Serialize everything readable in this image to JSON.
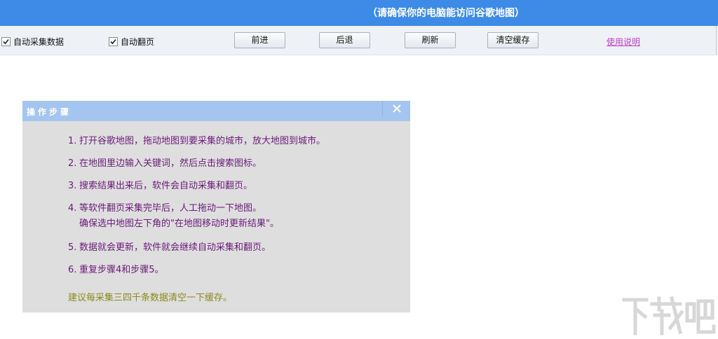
{
  "banner": {
    "text": "（请确保你的电脑能访问谷歌地图）",
    "color": "#3d8be6"
  },
  "toolbar": {
    "auto_collect_label": "自动采集数据",
    "auto_collect_checked": true,
    "auto_page_label": "自动翻页",
    "auto_page_checked": true,
    "forward_label": "前进",
    "back_label": "后退",
    "refresh_label": "刷新",
    "clear_cache_label": "清空缓存",
    "help_label": "使用说明"
  },
  "panel": {
    "title": "操作步骤",
    "close_icon": "close-icon",
    "steps": [
      {
        "num": "1.",
        "text": "打开谷歌地图，拖动地图到要采集的城市，放大地图到城市。"
      },
      {
        "num": "2.",
        "text": "在地图里边输入关键词，然后点击搜索图标。"
      },
      {
        "num": "3.",
        "text": "搜索结果出来后，软件会自动采集和翻页。"
      },
      {
        "num": "4.",
        "text": "等软件翻页采集完毕后，人工拖动一下地图。",
        "text2": "确保选中地图左下角的\"在地图移动时更新结果\"。"
      },
      {
        "num": "5.",
        "text": "数据就会更新，软件就会继续自动采集和翻页。"
      },
      {
        "num": "6.",
        "text": "重复步骤4和步骤5。"
      }
    ],
    "tip": "建议每采集三四千条数据清空一下缓存。",
    "step_color": "#6a1a78",
    "tip_color": "#8a8a1e"
  },
  "watermark": {
    "text": "下载吧"
  }
}
